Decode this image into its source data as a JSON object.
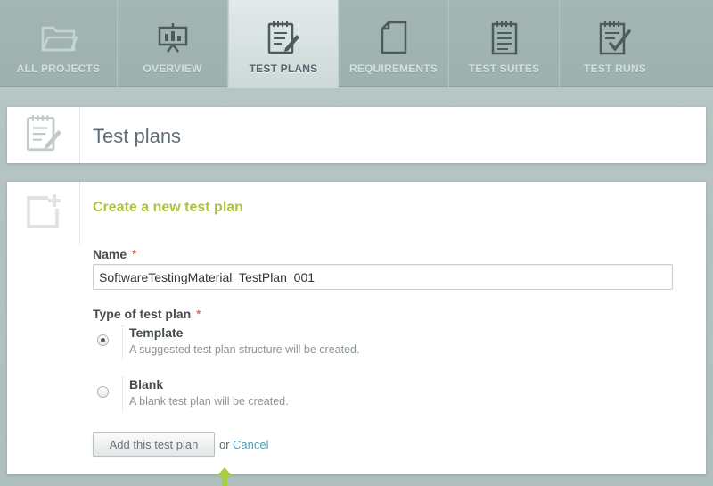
{
  "nav": {
    "tabs": [
      {
        "label": "ALL PROJECTS",
        "icon": "folder-icon",
        "active": false
      },
      {
        "label": "OVERVIEW",
        "icon": "presentation-board-icon",
        "active": false
      },
      {
        "label": "TEST PLANS",
        "icon": "test-plan-pencil-icon",
        "active": true
      },
      {
        "label": "REQUIREMENTS",
        "icon": "document-icon",
        "active": false
      },
      {
        "label": "TEST SUITES",
        "icon": "notepad-icon",
        "active": false
      },
      {
        "label": "TEST RUNS",
        "icon": "checklist-icon",
        "active": false
      }
    ]
  },
  "header": {
    "title": "Test plans",
    "icon": "test-plan-pencil-icon"
  },
  "form": {
    "icon": "add-new-icon",
    "title": "Create a new test plan",
    "name_label": "Name",
    "required_mark": "*",
    "name_value": "SoftwareTestingMaterial_TestPlan_001",
    "type_label": "Type of test plan",
    "options": [
      {
        "title": "Template",
        "description": "A suggested test plan structure will be created.",
        "checked": true
      },
      {
        "title": "Blank",
        "description": "A blank test plan will be created.",
        "checked": false
      }
    ],
    "submit_label": "Add this test plan",
    "or_text": "or",
    "cancel_label": "Cancel"
  },
  "colors": {
    "accent_green": "#a9c23f",
    "link_blue": "#4aa0bd",
    "required_red": "#d04a3a"
  }
}
